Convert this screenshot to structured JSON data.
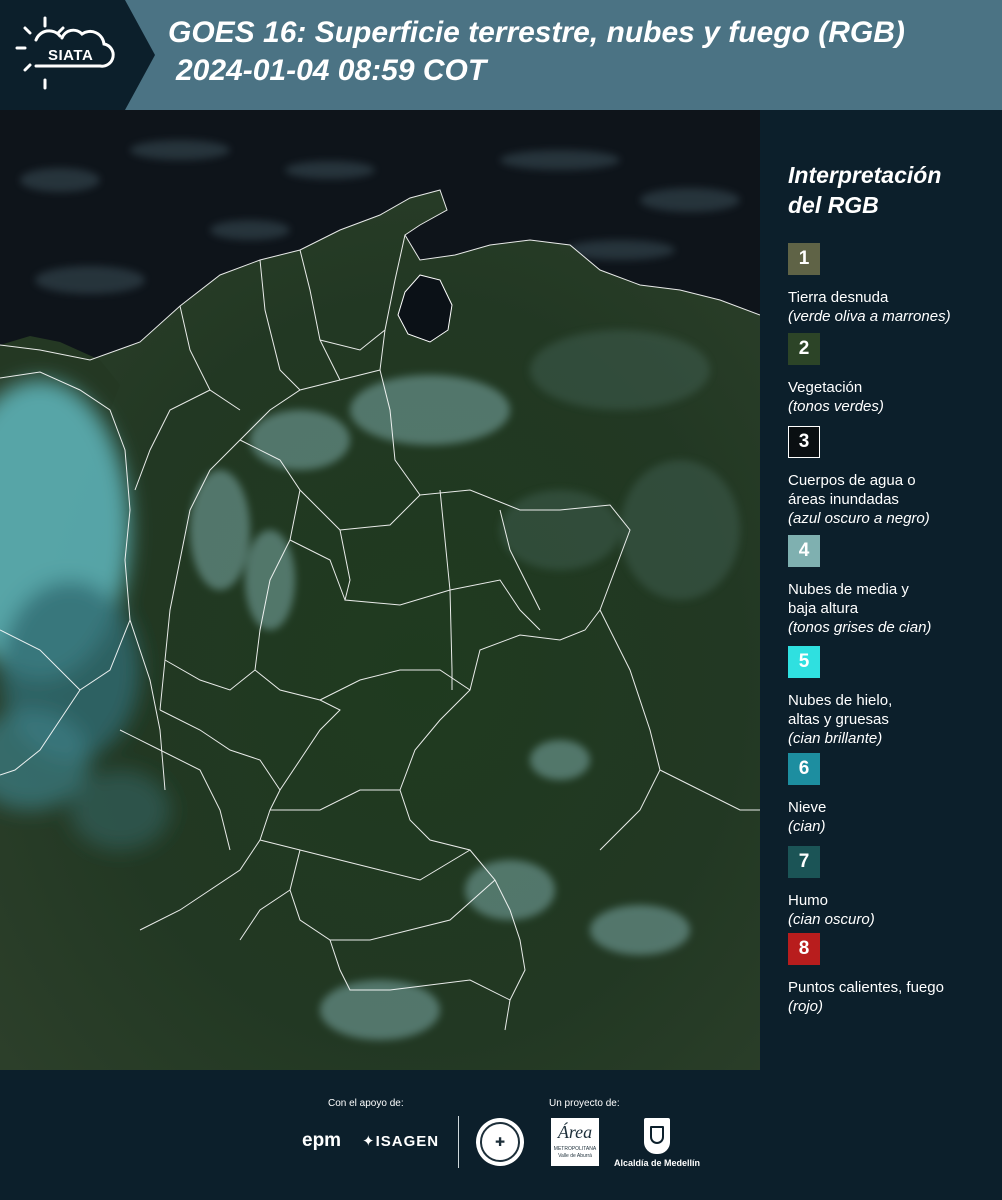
{
  "header": {
    "logo_text": "SIATA",
    "title": "GOES 16: Superficie terrestre, nubes y fuego (RGB)",
    "timestamp": "2024-01-04 08:59 COT"
  },
  "legend": {
    "heading_line1": "Interpretación",
    "heading_line2": "del RGB",
    "items": [
      {
        "number": "1",
        "color": "#5f6346",
        "label": [
          "Tierra desnuda"
        ],
        "desc": "(verde oliva a marrones)"
      },
      {
        "number": "2",
        "color": "#2c4427",
        "label": [
          "Vegetación"
        ],
        "desc": "(tonos verdes)"
      },
      {
        "number": "3",
        "color": "#0a0f12",
        "label": [
          "Cuerpos de agua o",
          "áreas inundadas"
        ],
        "desc": "(azul oscuro a negro)"
      },
      {
        "number": "4",
        "color": "#7fb0b0",
        "label": [
          "Nubes de media y",
          "baja altura"
        ],
        "desc": "(tonos grises de cian)"
      },
      {
        "number": "5",
        "color": "#2fe0e0",
        "label": [
          "Nubes de hielo,",
          "altas y gruesas"
        ],
        "desc": "(cian brillante)"
      },
      {
        "number": "6",
        "color": "#1d8ea0",
        "label": [
          "Nieve"
        ],
        "desc": "(cian)"
      },
      {
        "number": "7",
        "color": "#1b5456",
        "label": [
          "Humo"
        ],
        "desc": "(cian oscuro)"
      },
      {
        "number": "8",
        "color": "#b81d1d",
        "label": [
          "Puntos calientes, fuego"
        ],
        "desc": "(rojo)"
      }
    ]
  },
  "footer": {
    "support_label": "Con el apoyo de:",
    "project_label": "Un proyecto de:",
    "epm_logo": "epm",
    "isagen_logo": "ISAGEN",
    "area_logo_big": "Área",
    "area_logo_small": "METROPOLITANA Valle de Aburrá",
    "medellin_label": "Alcaldía de Medellín"
  },
  "colors": {
    "header_bg": "#4b7384",
    "panel_bg": "#0c1f2b",
    "ocean": "#0e141a",
    "land": "#22381f"
  }
}
